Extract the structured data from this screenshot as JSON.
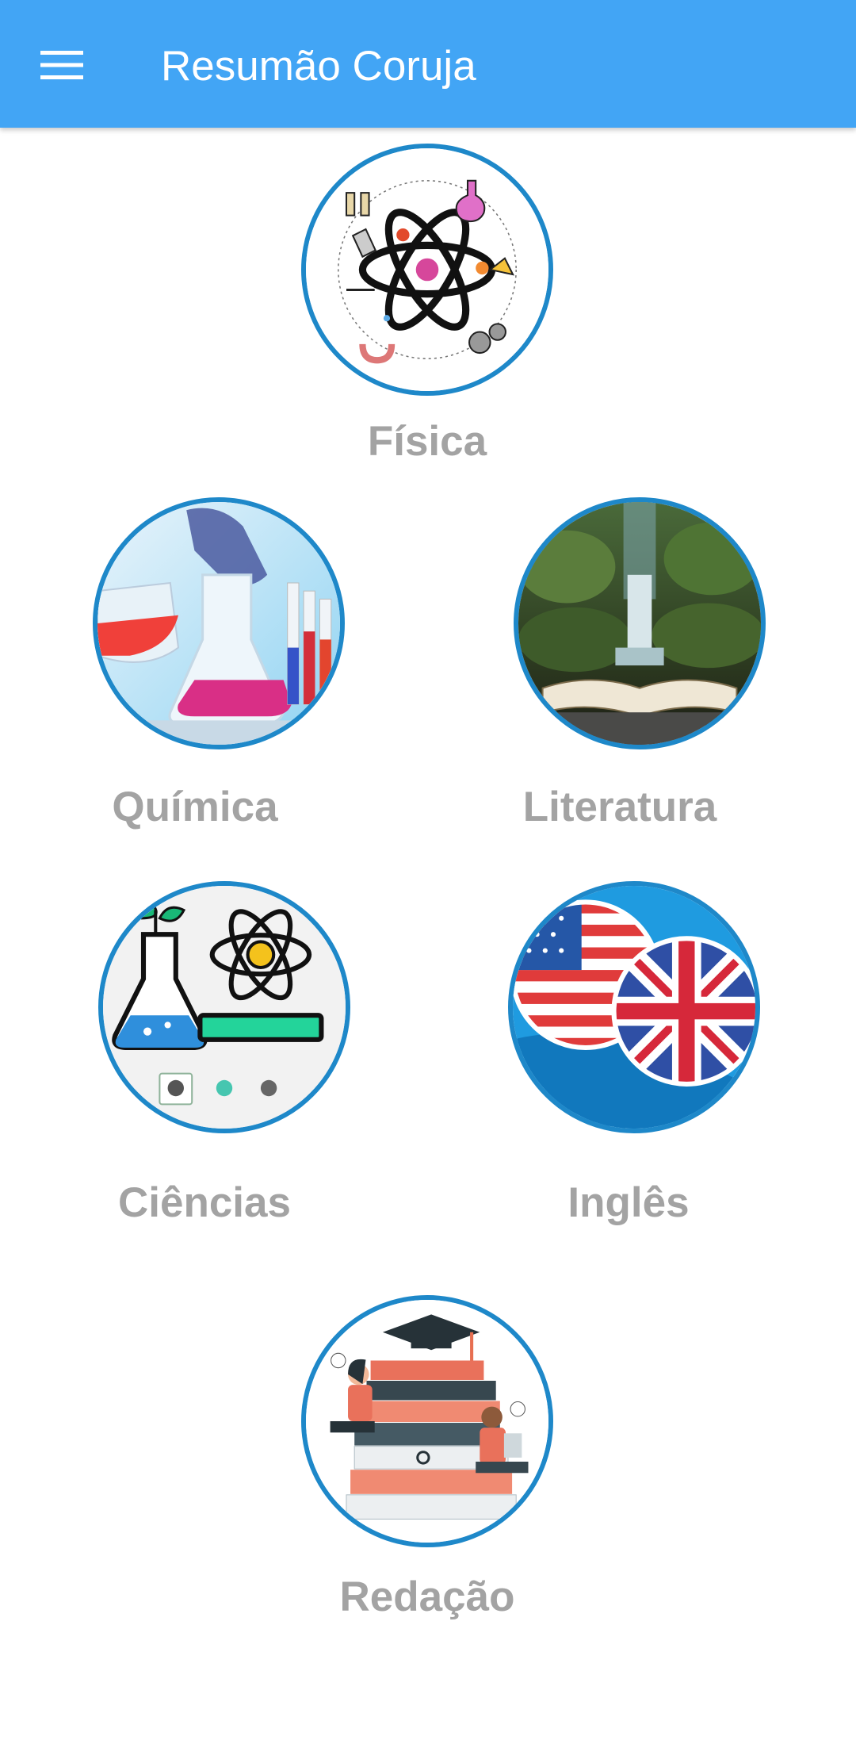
{
  "appbar": {
    "title": "Resumão Coruja",
    "menu_icon": "hamburger-menu-icon",
    "background": "#42a5f5"
  },
  "accent_ring_color": "#1e88c9",
  "label_color": "#a3a3a3",
  "subjects": {
    "fisica": {
      "label": "Física",
      "image": "atom-science-illustration"
    },
    "quimica": {
      "label": "Química",
      "image": "laboratory-flasks-photo"
    },
    "literatura": {
      "label": "Literatura",
      "image": "open-book-waterfall-photo"
    },
    "ciencias": {
      "label": "Ciências",
      "image": "science-flask-atom-illustration"
    },
    "ingles": {
      "label": "Inglês",
      "image": "us-uk-flags-illustration"
    },
    "redacao": {
      "label": "Redação",
      "image": "stacked-books-students-illustration"
    }
  }
}
